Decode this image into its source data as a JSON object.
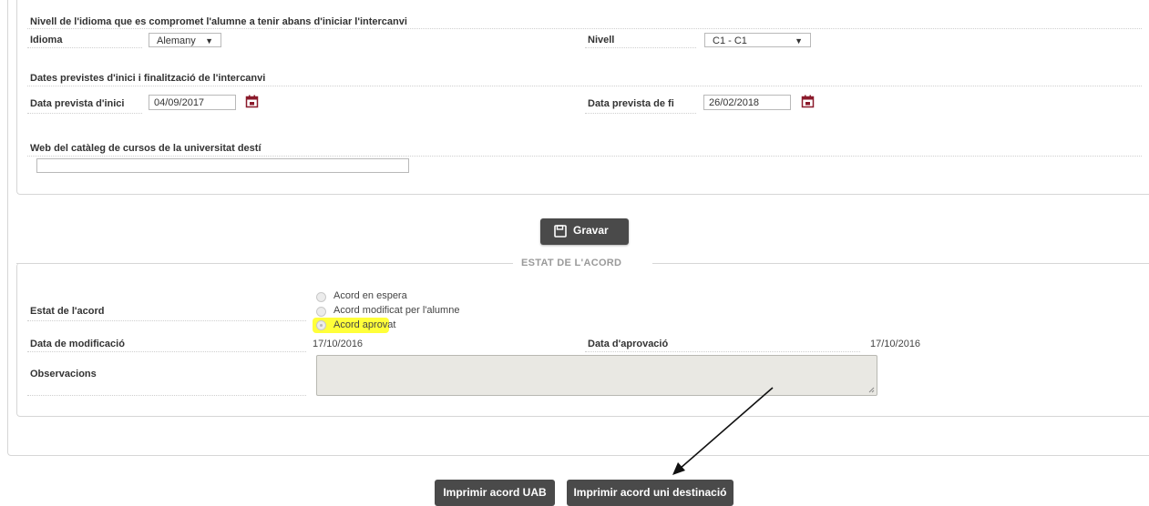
{
  "language_section": {
    "title": "Nivell de l'idioma que es compromet l'alumne a tenir abans d'iniciar l'intercanvi",
    "idioma_label": "Idioma",
    "idioma_value": "Alemany",
    "nivell_label": "Nivell",
    "nivell_value": "C1 - C1"
  },
  "dates_section": {
    "title": "Dates previstes d'inici i finalització de l'intercanvi",
    "start_label": "Data prevista d'inici",
    "start_value": "04/09/2017",
    "end_label": "Data prevista de fi",
    "end_value": "26/02/2018"
  },
  "web_section": {
    "title": "Web del catàleg de cursos de la universitat destí",
    "value": ""
  },
  "save_button": {
    "label": "Gravar"
  },
  "agreement_status": {
    "legend": "ESTAT DE L'ACORD",
    "status_label": "Estat de l'acord",
    "options": [
      "Acord en espera",
      "Acord modificat per l'alumne",
      "Acord aprovat"
    ],
    "selected": "Acord aprovat",
    "modified_label": "Data de modificació",
    "modified_value": "17/10/2016",
    "approval_label": "Data d'aprovació",
    "approval_value": "17/10/2016",
    "observations_label": "Observacions",
    "observations_value": ""
  },
  "print_buttons": {
    "uab_label": "Imprimir acord UAB",
    "destination_label": "Imprimir acord uni destinació"
  },
  "colors": {
    "button_bg": "#4a4a4a",
    "calendar_icon": "#8b1a2b",
    "highlight": "#ffff3a"
  }
}
